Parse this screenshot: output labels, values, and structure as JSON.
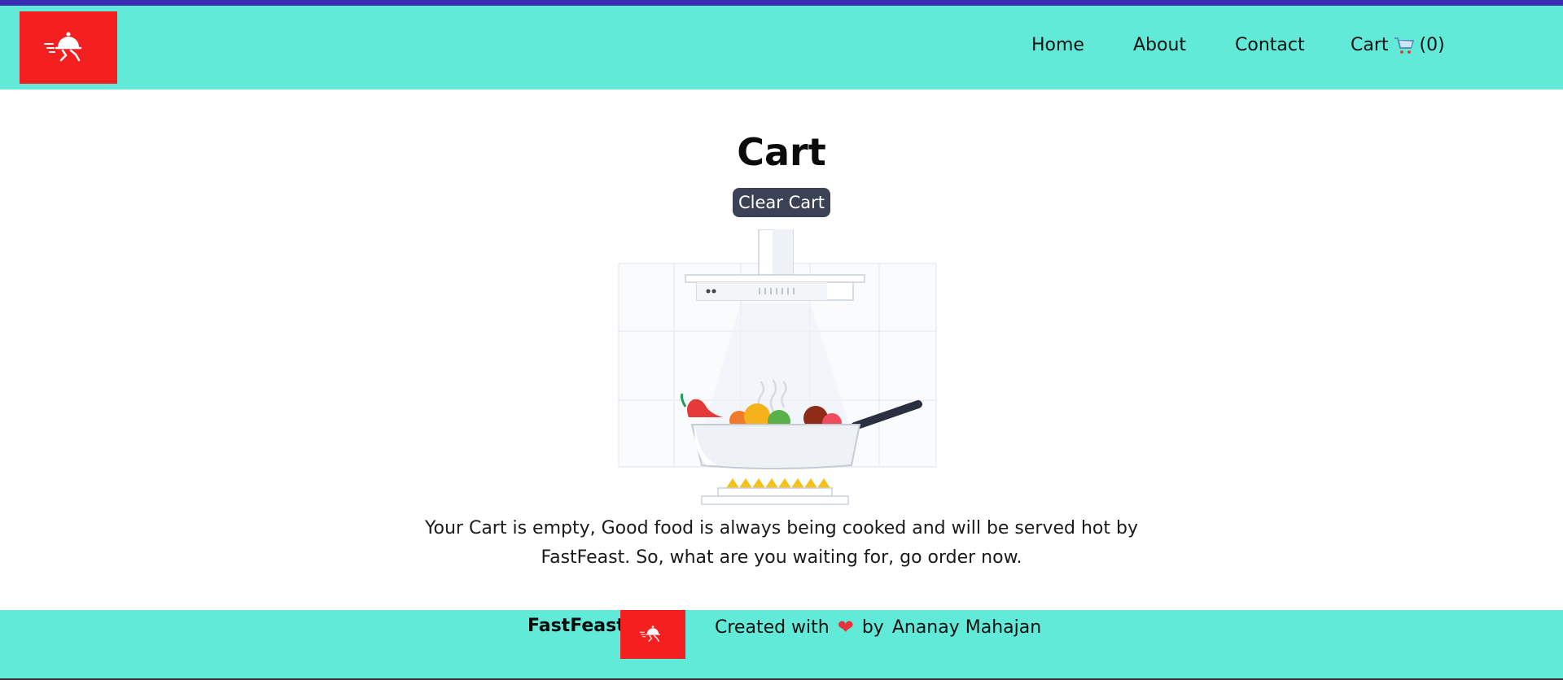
{
  "header": {
    "logo_alt": "FastFeast logo",
    "nav": [
      {
        "label": "Home"
      },
      {
        "label": "About"
      },
      {
        "label": "Contact"
      }
    ],
    "cart": {
      "label": "Cart",
      "count_text": "(0)",
      "icon": "shopping-cart-icon"
    }
  },
  "main": {
    "title": "Cart",
    "clear_button": "Clear Cart",
    "empty_message": "Your Cart is empty, Good food is always being cooked and will be served hot by FastFeast. So, what are you waiting for, go order now."
  },
  "footer": {
    "brand": "FastFeast",
    "created_prefix": "Created with",
    "heart_icon": "heart-icon",
    "created_by": "by",
    "author": "Ananay Mahajan"
  },
  "colors": {
    "header_bg": "#61ead8",
    "logo_bg": "#f41f1f",
    "button_bg": "#3b4255",
    "topline": "#3b2cb4"
  }
}
